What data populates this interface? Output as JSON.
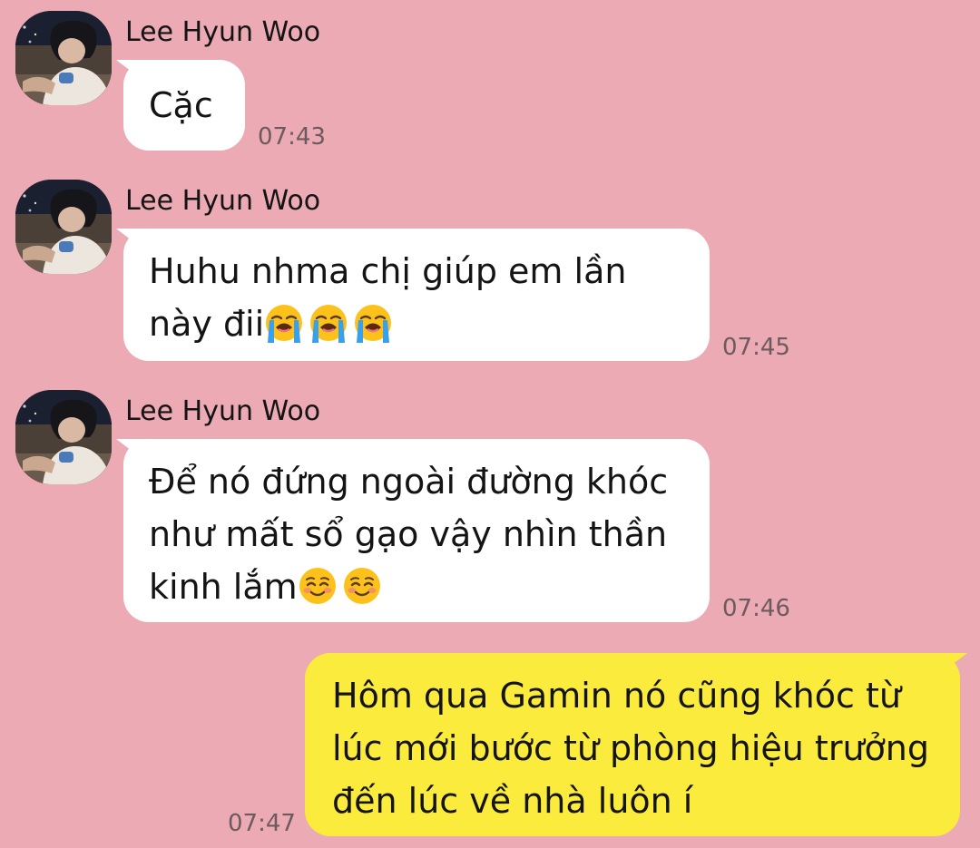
{
  "messages": [
    {
      "sender": "Lee Hyun Woo",
      "lines": [
        "Cặc"
      ],
      "time": "07:43"
    },
    {
      "sender": "Lee Hyun Woo",
      "lines": [
        "Huhu nhma chị giúp em lần",
        "này đii"
      ],
      "time": "07:45",
      "emojis": [
        "loudly-crying-face",
        "loudly-crying-face",
        "loudly-crying-face"
      ]
    },
    {
      "sender": "Lee Hyun Woo",
      "lines": [
        "Để nó đứng ngoài đường khóc",
        "như mất sổ gạo vậy nhìn thần",
        "kinh lắm"
      ],
      "time": "07:46",
      "emojis": [
        "smiling-face",
        "smiling-face"
      ]
    },
    {
      "lines": [
        "Hôm qua Gamin nó cũng khóc từ",
        "lúc mới bước từ phòng hiệu trưởng",
        "đến lúc về nhà luôn í"
      ],
      "time": "07:47"
    }
  ],
  "colors": {
    "background": "#ebaab4",
    "incoming_bubble": "#ffffff",
    "outgoing_bubble": "#fbeb3c"
  }
}
